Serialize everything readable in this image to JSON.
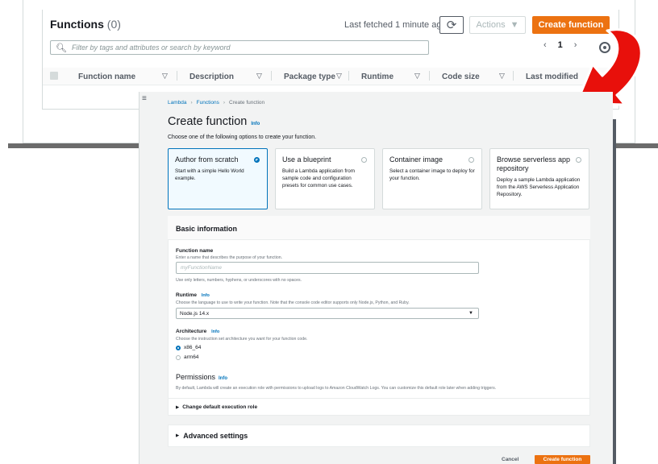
{
  "functions_list": {
    "title": "Functions",
    "count": "(0)",
    "last_fetched": "Last fetched 1 minute ago",
    "actions_label": "Actions",
    "create_label": "Create function",
    "filter_placeholder": "Filter by tags and attributes or search by keyword",
    "page_number": "1",
    "columns": [
      "Function name",
      "Description",
      "Package type",
      "Runtime",
      "Code size",
      "Last modified"
    ]
  },
  "create_page": {
    "breadcrumb": [
      "Lambda",
      "Functions",
      "Create function"
    ],
    "title": "Create function",
    "info": "Info",
    "subtitle": "Choose one of the following options to create your function.",
    "options": [
      {
        "title": "Author from scratch",
        "desc": "Start with a simple Hello World example.",
        "selected": true
      },
      {
        "title": "Use a blueprint",
        "desc": "Build a Lambda application from sample code and configuration presets for common use cases.",
        "selected": false
      },
      {
        "title": "Container image",
        "desc": "Select a container image to deploy for your function.",
        "selected": false
      },
      {
        "title": "Browse serverless app repository",
        "desc": "Deploy a sample Lambda application from the AWS Serverless Application Repository.",
        "selected": false
      }
    ],
    "basic_info": {
      "title": "Basic information",
      "function_name_label": "Function name",
      "function_name_desc": "Enter a name that describes the purpose of your function.",
      "function_name_placeholder": "myFunctionName",
      "function_name_hint": "Use only letters, numbers, hyphens, or underscores with no spaces.",
      "runtime_label": "Runtime",
      "runtime_desc": "Choose the language to use to write your function. Note that the console code editor supports only Node.js, Python, and Ruby.",
      "runtime_value": "Node.js 14.x",
      "arch_label": "Architecture",
      "arch_desc": "Choose the instruction set architecture you want for your function code.",
      "arch_options": [
        "x86_64",
        "arm64"
      ],
      "permissions_title": "Permissions",
      "permissions_desc": "By default, Lambda will create an execution role with permissions to upload logs to Amazon CloudWatch Logs. You can customize this default role later when adding triggers.",
      "change_role": "Change default execution role"
    },
    "advanced": "Advanced settings",
    "cancel": "Cancel",
    "create": "Create function"
  },
  "colors": {
    "accent_orange": "#ec7211",
    "link_blue": "#0073bb",
    "arrow_red": "#e8100b"
  }
}
